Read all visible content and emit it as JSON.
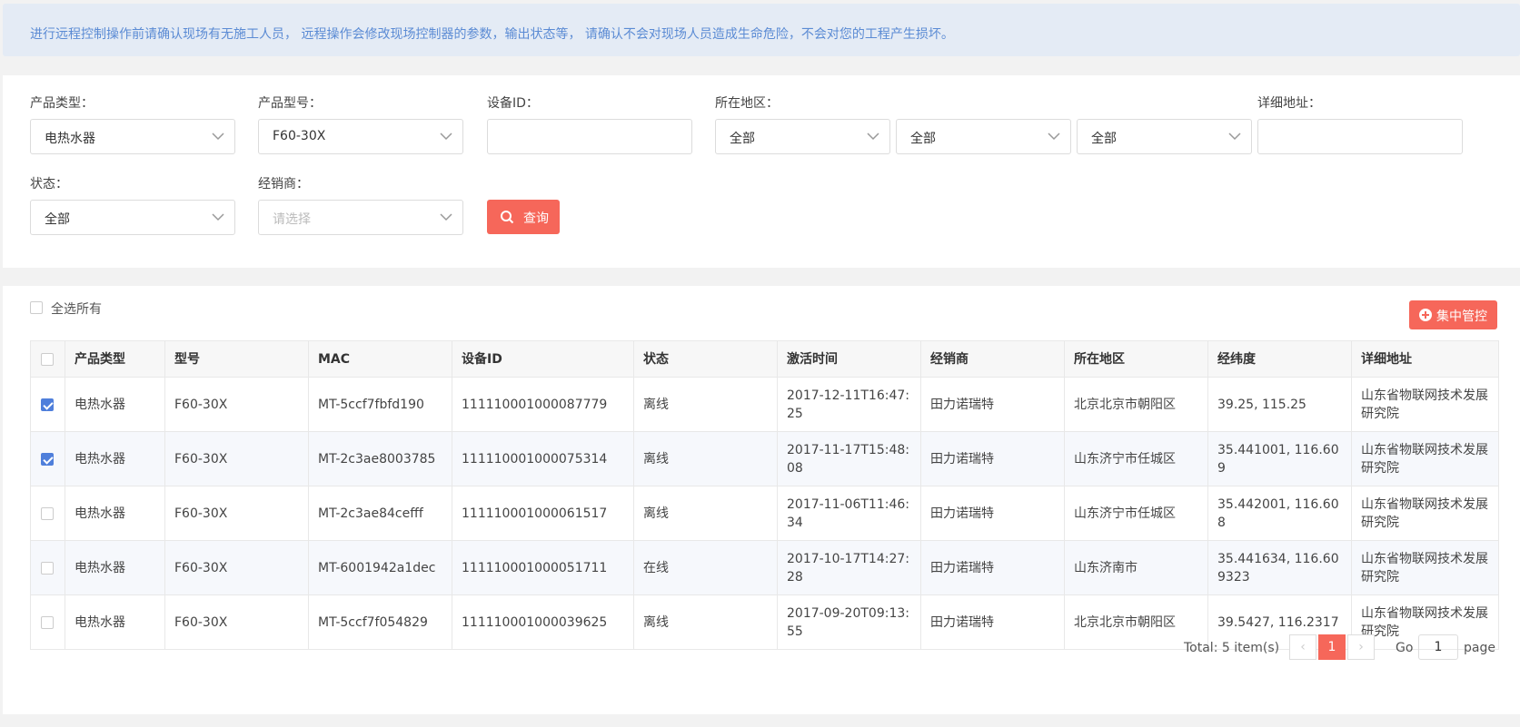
{
  "warning": "进行远程控制操作前请确认现场有无施工人员， 远程操作会修改现场控制器的参数，输出状态等， 请确认不会对现场人员造成生命危险，不会对您的工程产生损坏。",
  "filters": {
    "product_type": {
      "label": "产品类型：",
      "value": "电热水器"
    },
    "product_model": {
      "label": "产品型号：",
      "value": "F60-30X"
    },
    "device_id": {
      "label": "设备ID：",
      "value": ""
    },
    "region": {
      "label": "所在地区：",
      "province": "全部",
      "city": "全部",
      "district": "全部"
    },
    "address": {
      "label": "详细地址：",
      "value": ""
    },
    "status": {
      "label": "状态：",
      "value": "全部"
    },
    "dealer": {
      "label": "经销商：",
      "placeholder": "请选择"
    },
    "query_label": "查询"
  },
  "table_toolbar": {
    "select_all_label": "全选所有",
    "central_control_label": "集中管控"
  },
  "table": {
    "columns": [
      "产品类型",
      "型号",
      "MAC",
      "设备ID",
      "状态",
      "激活时间",
      "经销商",
      "所在地区",
      "经纬度",
      "详细地址"
    ],
    "rows": [
      {
        "checked": true,
        "type": "电热水器",
        "model": "F60-30X",
        "mac": "MT-5ccf7fbfd190",
        "device_id": "111110001000087779",
        "status": "离线",
        "activated": "2017-12-11T16:47:25",
        "dealer": "田力诺瑞特",
        "region": "北京北京市朝阳区",
        "latlng": "39.25, 115.25",
        "address": "山东省物联网技术发展研究院"
      },
      {
        "checked": true,
        "type": "电热水器",
        "model": "F60-30X",
        "mac": "MT-2c3ae8003785",
        "device_id": "111110001000075314",
        "status": "离线",
        "activated": "2017-11-17T15:48:08",
        "dealer": "田力诺瑞特",
        "region": "山东济宁市任城区",
        "latlng": "35.441001, 116.609",
        "address": "山东省物联网技术发展研究院"
      },
      {
        "checked": false,
        "type": "电热水器",
        "model": "F60-30X",
        "mac": "MT-2c3ae84cefff",
        "device_id": "111110001000061517",
        "status": "离线",
        "activated": "2017-11-06T11:46:34",
        "dealer": "田力诺瑞特",
        "region": "山东济宁市任城区",
        "latlng": "35.442001, 116.608",
        "address": "山东省物联网技术发展研究院"
      },
      {
        "checked": false,
        "type": "电热水器",
        "model": "F60-30X",
        "mac": "MT-6001942a1dec",
        "device_id": "111110001000051711",
        "status": "在线",
        "activated": "2017-10-17T14:27:28",
        "dealer": "田力诺瑞特",
        "region": "山东济南市",
        "latlng": "35.441634, 116.609323",
        "address": "山东省物联网技术发展研究院"
      },
      {
        "checked": false,
        "type": "电热水器",
        "model": "F60-30X",
        "mac": "MT-5ccf7f054829",
        "device_id": "111110001000039625",
        "status": "离线",
        "activated": "2017-09-20T09:13:55",
        "dealer": "田力诺瑞特",
        "region": "北京北京市朝阳区",
        "latlng": "39.5427, 116.2317",
        "address": "山东省物联网技术发展研究院"
      }
    ]
  },
  "pagination": {
    "total": "Total: 5 item(s)",
    "prev": "‹",
    "current": "1",
    "next": "›",
    "go_label": "Go",
    "go_value": "1",
    "page_label": "page"
  },
  "colors": {
    "accent": "#f6675a",
    "link": "#5b8bd4",
    "check": "#4f7fdb"
  }
}
